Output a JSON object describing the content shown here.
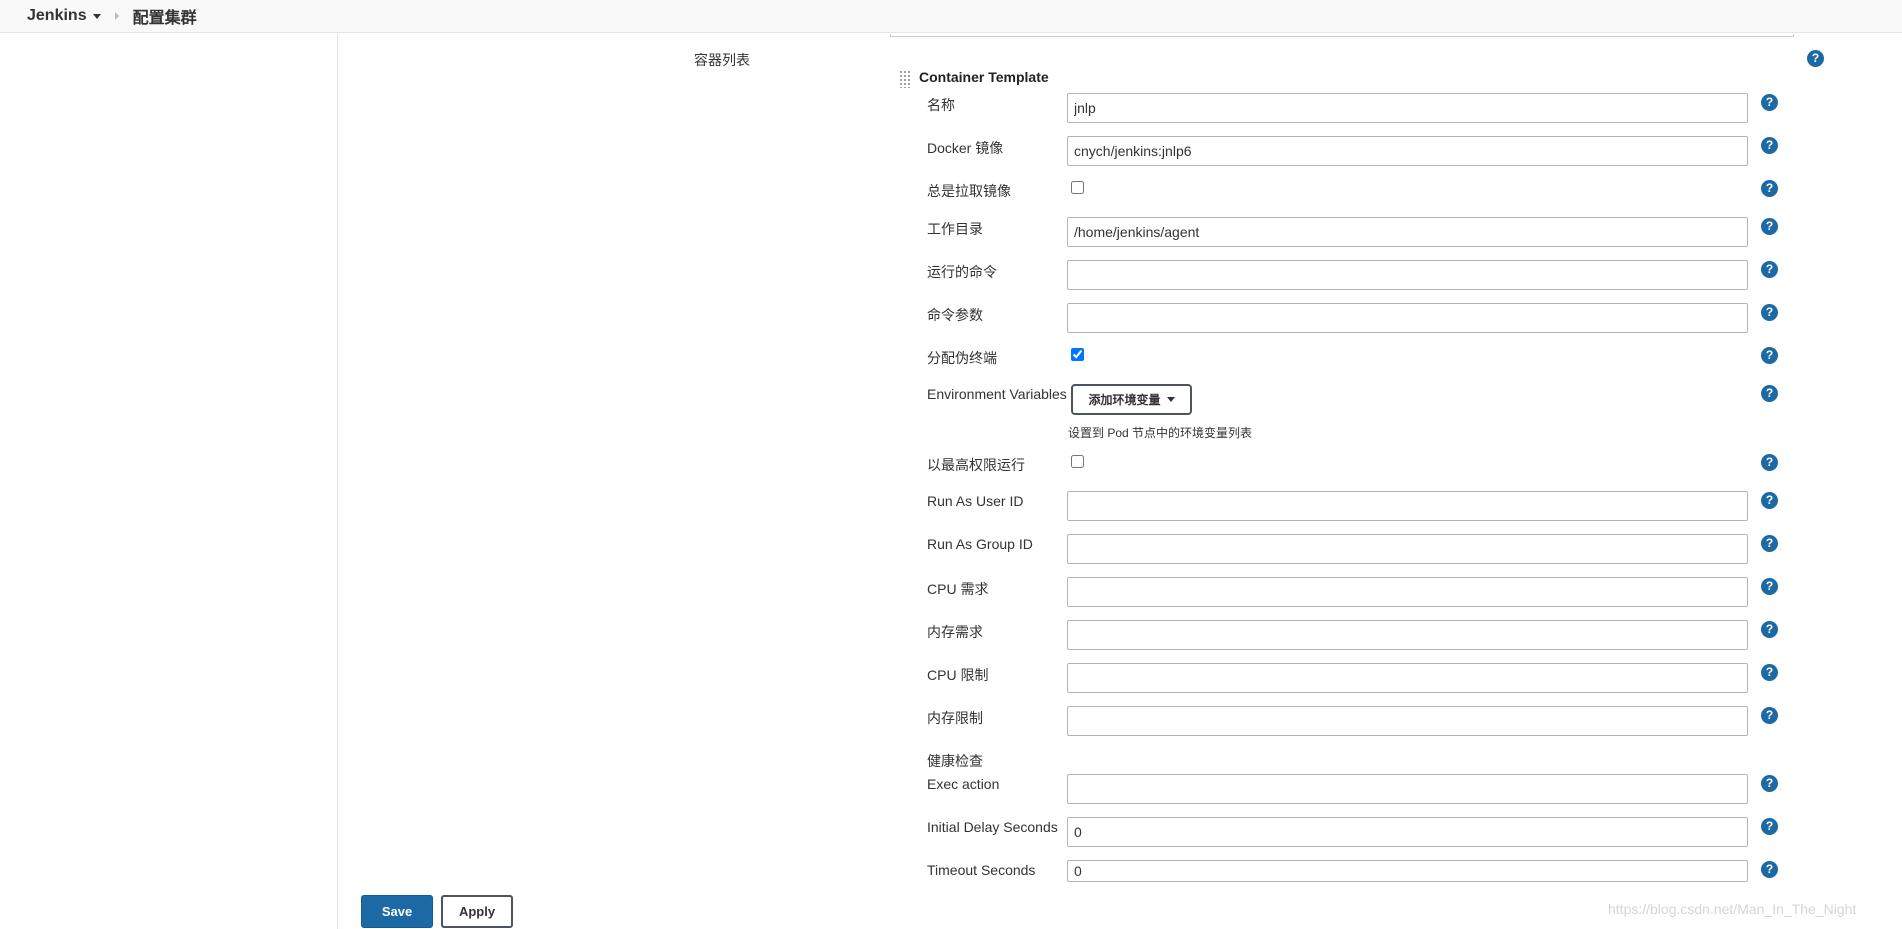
{
  "breadcrumb": {
    "root": "Jenkins",
    "current": "配置集群"
  },
  "section": {
    "label": "容器列表",
    "title": "Container Template"
  },
  "fields": {
    "name": {
      "label": "名称",
      "value": "jnlp"
    },
    "docker_image": {
      "label": "Docker 镜像",
      "value": "cnych/jenkins:jnlp6"
    },
    "always_pull": {
      "label": "总是拉取镜像",
      "checked": false
    },
    "working_dir": {
      "label": "工作目录",
      "value": "/home/jenkins/agent"
    },
    "command": {
      "label": "运行的命令",
      "value": ""
    },
    "args": {
      "label": "命令参数",
      "value": ""
    },
    "tty": {
      "label": "分配伪终端",
      "checked": true
    },
    "env_vars": {
      "label": "Environment Variables",
      "button": "添加环境变量",
      "hint": "设置到 Pod 节点中的环境变量列表"
    },
    "privileged": {
      "label": "以最高权限运行",
      "checked": false
    },
    "run_as_user": {
      "label": "Run As User ID",
      "value": ""
    },
    "run_as_group": {
      "label": "Run As Group ID",
      "value": ""
    },
    "cpu_request": {
      "label": "CPU 需求",
      "value": ""
    },
    "memory_request": {
      "label": "内存需求",
      "value": ""
    },
    "cpu_limit": {
      "label": "CPU 限制",
      "value": ""
    },
    "memory_limit": {
      "label": "内存限制",
      "value": ""
    },
    "health_check": {
      "label": "健康检查"
    },
    "exec_action": {
      "label": "Exec action",
      "value": ""
    },
    "initial_delay": {
      "label": "Initial Delay Seconds",
      "value": "0"
    },
    "timeout": {
      "label": "Timeout Seconds",
      "value": "0"
    }
  },
  "help_glyph": "?",
  "buttons": {
    "save": "Save",
    "apply": "Apply"
  },
  "watermark": "https://blog.csdn.net/Man_In_The_Night",
  "colors": {
    "accent": "#1b6aa5"
  }
}
